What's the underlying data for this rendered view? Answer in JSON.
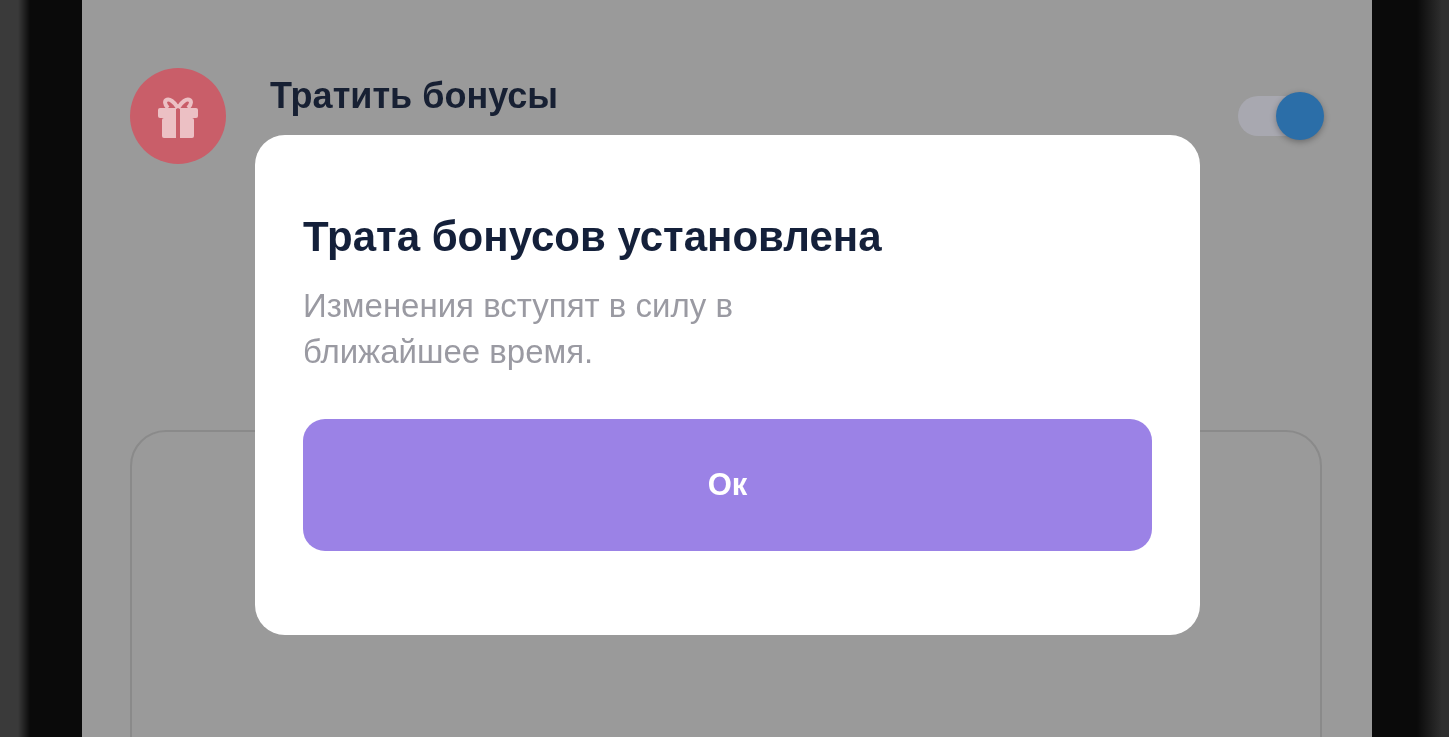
{
  "setting": {
    "title": "Тратить бонусы",
    "toggle": {
      "on": true
    }
  },
  "dialog": {
    "title": "Трата бонусов установлена",
    "message": "Изменения вступят в силу в ближайшее время.",
    "button": "Ок"
  }
}
